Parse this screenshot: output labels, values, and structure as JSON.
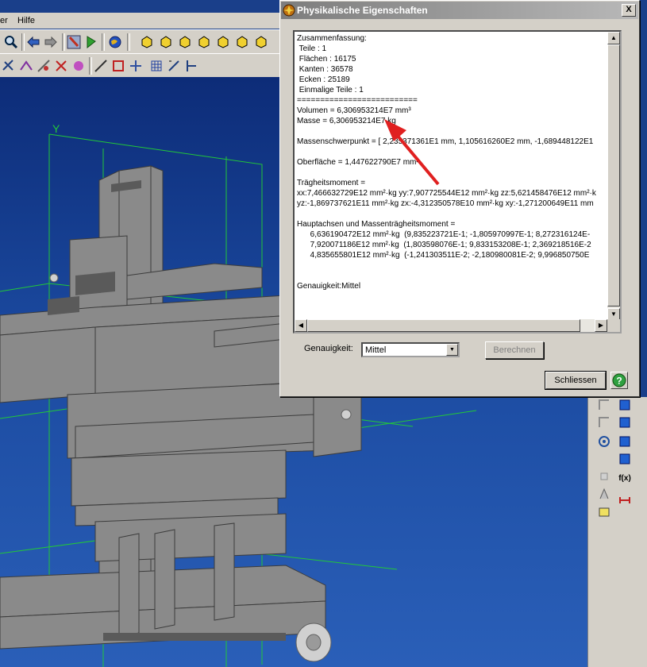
{
  "menu": {
    "item_partial": "er",
    "help": "Hilfe"
  },
  "dialog": {
    "title": "Physikalische Eigenschaften",
    "close_glyph": "X",
    "text_lines": [
      "Zusammenfassung:",
      " Teile : 1",
      " Flächen : 16175",
      " Kanten : 36578",
      " Ecken : 25189",
      " Einmalige Teile : 1",
      "==========================",
      "Volumen = 6,306953214E7 mm³",
      "Masse = 6,306953214E7 kg",
      "",
      "Massenschwerpunkt = [ 2,235371361E1 mm, 1,105616260E2 mm, -1,689448122E1",
      "",
      "Oberfläche = 1,447622790E7 mm²",
      "",
      "Trägheitsmoment =",
      "xx:7,466632729E12 mm²·kg yy:7,907725544E12 mm²·kg zz:5,621458476E12 mm²·k",
      "yz:-1,869737621E11 mm²·kg zx:-4,312350578E10 mm²·kg xy:-1,271200649E11 mm",
      "",
      "Hauptachsen und Massenträgheitsmoment =",
      "      6,636190472E12 mm²·kg  (9,835223721E-1; -1,805970997E-1; 8,272316124E-",
      "      7,920071186E12 mm²·kg  (1,803598076E-1; 9,833153208E-1; 2,369218516E-2",
      "      4,835655801E12 mm²·kg  (-1,241303511E-2; -2,180980081E-2; 9,996850750E",
      "",
      "",
      "Genauigkeit:Mittel"
    ],
    "accuracy_label": "Genauigkeit:",
    "accuracy_value": "Mittel",
    "calc_button": "Berechnen",
    "close_button": "Schliessen",
    "help_glyph": "?"
  },
  "viewport": {
    "axis_label": "Y",
    "background": "#1b4aa0"
  },
  "colors": {
    "dialog_bg": "#d4d0c8",
    "arrow": "#e02020",
    "grid": "#22c838"
  },
  "icons": [
    "search-icon",
    "back-arrow-icon",
    "forward-arrow-icon",
    "select-tool-icon",
    "flag-icon",
    "globe-icon",
    "cube-view-icon",
    "help-icon"
  ]
}
